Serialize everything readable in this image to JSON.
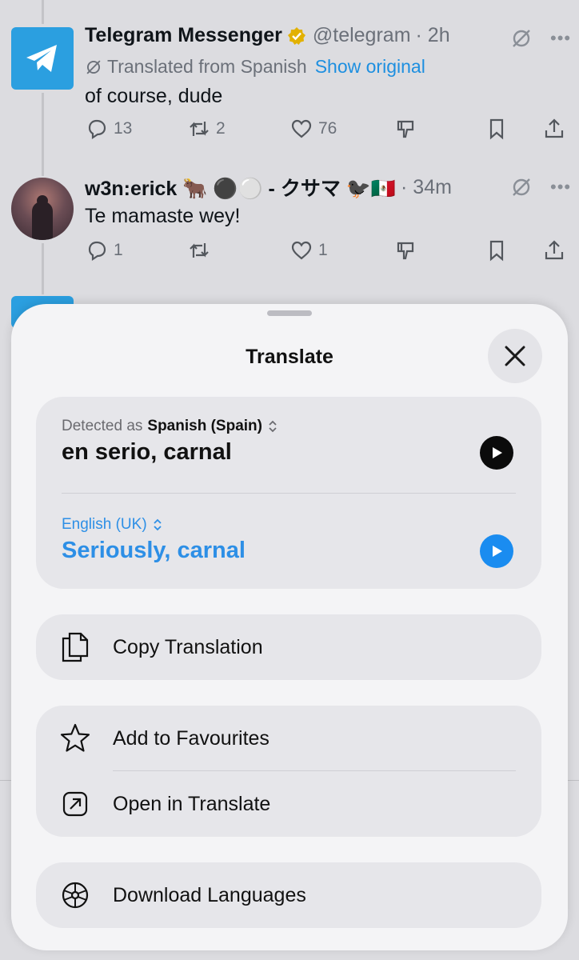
{
  "tweet1": {
    "name": "Telegram Messenger",
    "handle": "@telegram",
    "time": "· 2h",
    "translated_from": "Translated from Spanish",
    "show_original": "Show original",
    "text": "of course, dude",
    "replies": "13",
    "retweets": "2",
    "likes": "76"
  },
  "tweet2": {
    "name": "w3n:erick 🐂 ⚫⚪ - クサマ 🐦‍⬛🇲🇽",
    "time": "· 34m",
    "text": "Te mamaste wey!",
    "replies": "1",
    "retweets": "",
    "likes": "1"
  },
  "sheet": {
    "title": "Translate",
    "detected_prefix": "Detected as",
    "source_language": "Spanish (Spain)",
    "source_text": "en serio, carnal",
    "target_language": "English (UK)",
    "target_text": "Seriously, carnal",
    "copy_label": "Copy Translation",
    "favourites_label": "Add to Favourites",
    "open_label": "Open in Translate",
    "download_label": "Download Languages"
  },
  "colors": {
    "accent": "#1a8cf0",
    "telegram_blue": "#2b9fe0",
    "sheet_bg": "#f4f4f6",
    "card_bg": "#e6e6ea"
  }
}
